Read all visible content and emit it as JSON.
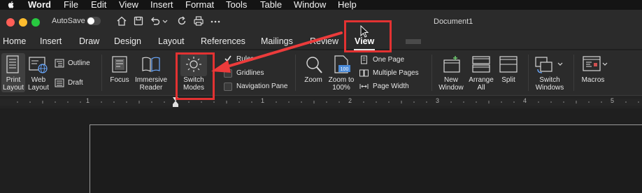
{
  "menubar": {
    "app_name": "Word",
    "items": [
      "File",
      "Edit",
      "View",
      "Insert",
      "Format",
      "Tools",
      "Table",
      "Window",
      "Help"
    ]
  },
  "titlebar": {
    "autosave_label": "AutoSave",
    "document_title": "Document1"
  },
  "tabs": [
    "Home",
    "Insert",
    "Draw",
    "Design",
    "Layout",
    "References",
    "Mailings",
    "Review",
    "View"
  ],
  "active_tab": "View",
  "ribbon": {
    "print_layout": "Print Layout",
    "web_layout": "Web Layout",
    "outline": "Outline",
    "draft": "Draft",
    "focus": "Focus",
    "immersive_reader": "Immersive Reader",
    "switch_modes": "Switch Modes",
    "ruler": "Ruler",
    "gridlines": "Gridlines",
    "navigation_pane": "Navigation Pane",
    "zoom": "Zoom",
    "zoom_100": "Zoom to 100%",
    "one_page": "One Page",
    "multiple_pages": "Multiple Pages",
    "page_width": "Page Width",
    "new_window": "New Window",
    "arrange_all": "Arrange All",
    "split": "Split",
    "switch_windows": "Switch Windows",
    "macros": "Macros"
  },
  "ruler_ticks": [
    "1",
    "1",
    "2",
    "3",
    "4",
    "5"
  ],
  "colors": {
    "accent_annotation": "#e23232",
    "background": "#1f1f1f",
    "ribbon": "#2b2b2b"
  }
}
